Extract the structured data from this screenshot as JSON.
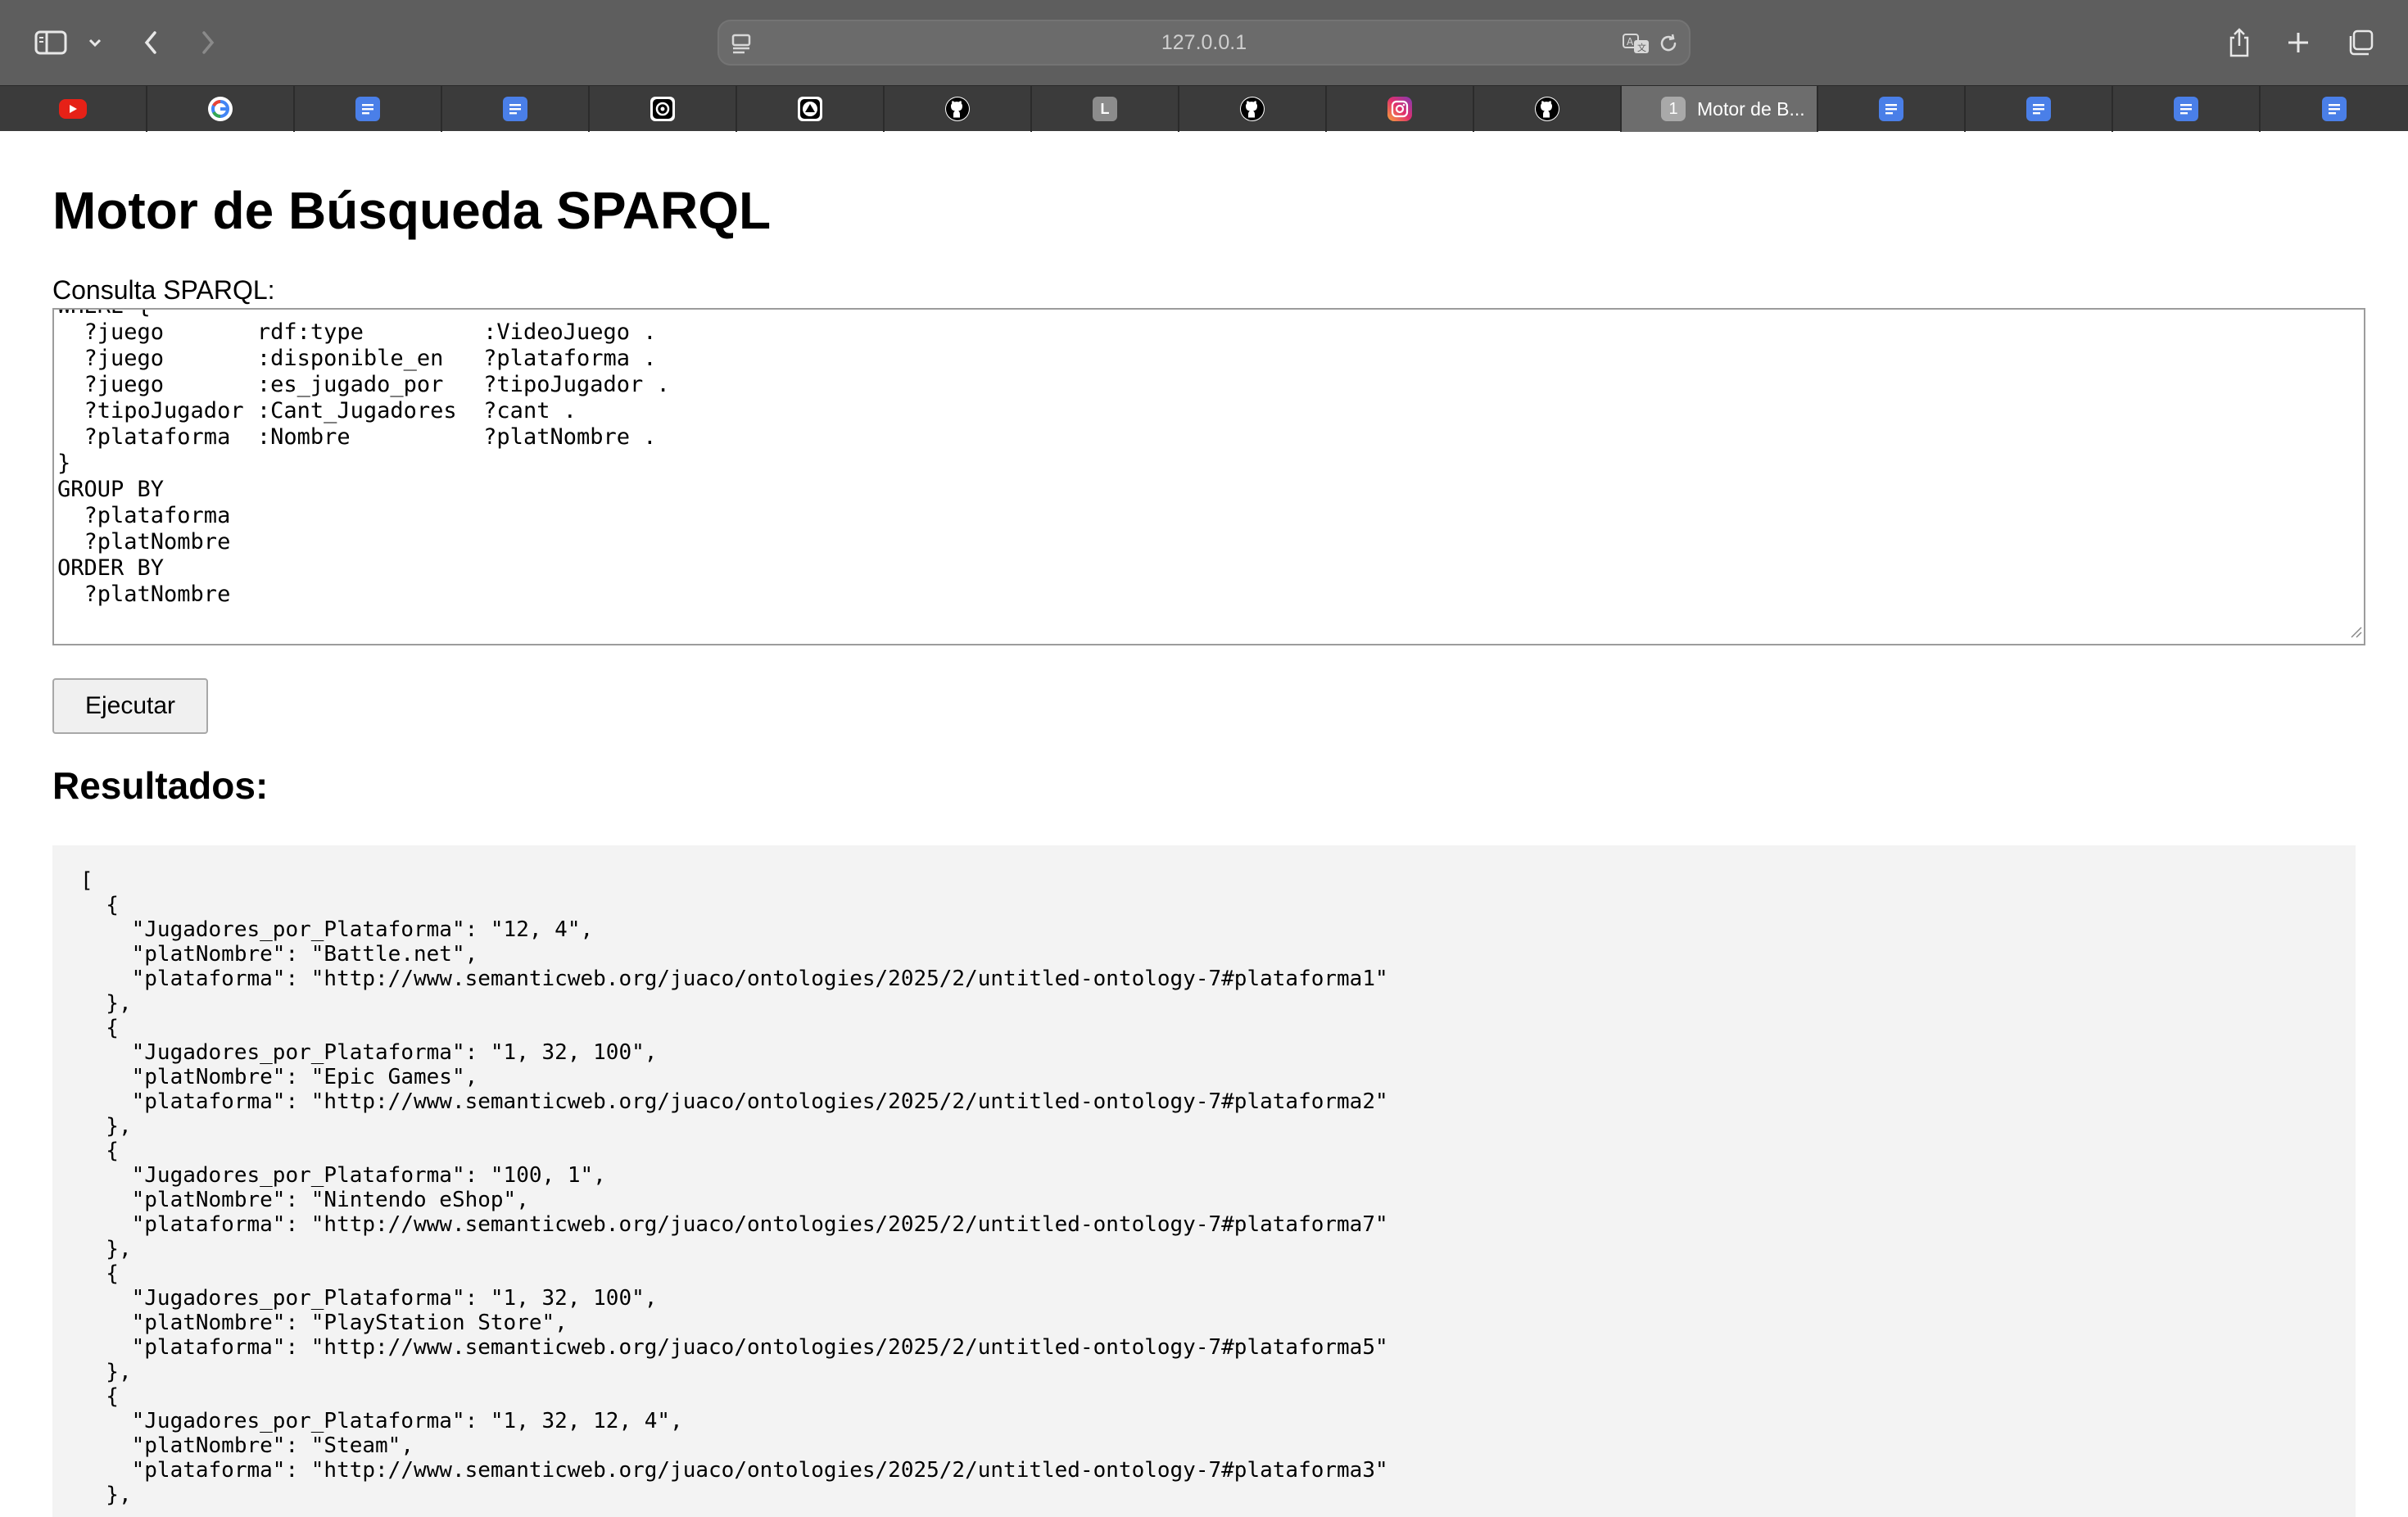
{
  "browser": {
    "url": "127.0.0.1",
    "tabs": [
      {
        "icon": "youtube-icon",
        "color": "#e62117"
      },
      {
        "icon": "google-icon",
        "color": "#ffffff"
      },
      {
        "icon": "google-docs-icon",
        "color": "#4a7fe8"
      },
      {
        "icon": "google-docs-icon",
        "color": "#4a7fe8"
      },
      {
        "icon": "openai-icon",
        "color": "#000000"
      },
      {
        "icon": "notion-like-icon",
        "color": "#000000"
      },
      {
        "icon": "github-icon",
        "color": "#000000"
      },
      {
        "icon": "letter-l-icon",
        "color": "#8c8c8c",
        "letter": "L"
      },
      {
        "icon": "github-icon",
        "color": "#000000"
      },
      {
        "icon": "instagram-icon",
        "color": "#d6249f"
      },
      {
        "icon": "github-icon",
        "color": "#000000"
      },
      {
        "active": true,
        "badge": "1",
        "title": "Motor de B..."
      },
      {
        "icon": "google-docs-icon",
        "color": "#4a7fe8"
      },
      {
        "icon": "google-docs-icon",
        "color": "#4a7fe8"
      },
      {
        "icon": "google-docs-icon",
        "color": "#4a7fe8"
      },
      {
        "icon": "google-docs-icon",
        "color": "#4a7fe8"
      }
    ]
  },
  "page": {
    "title": "Motor de Búsqueda SPARQL",
    "query_label": "Consulta SPARQL:",
    "query_text": "WHERE {\n  ?juego       rdf:type         :VideoJuego .\n  ?juego       :disponible_en   ?plataforma .\n  ?juego       :es_jugado_por   ?tipoJugador .\n  ?tipoJugador :Cant_Jugadores  ?cant .\n  ?plataforma  :Nombre          ?platNombre .\n}\nGROUP BY\n  ?plataforma\n  ?platNombre\nORDER BY\n  ?platNombre",
    "run_button": "Ejecutar",
    "results_heading": "Resultados:",
    "results_text": "[\n  {\n    \"Jugadores_por_Plataforma\": \"12, 4\",\n    \"platNombre\": \"Battle.net\",\n    \"plataforma\": \"http://www.semanticweb.org/juaco/ontologies/2025/2/untitled-ontology-7#plataforma1\"\n  },\n  {\n    \"Jugadores_por_Plataforma\": \"1, 32, 100\",\n    \"platNombre\": \"Epic Games\",\n    \"plataforma\": \"http://www.semanticweb.org/juaco/ontologies/2025/2/untitled-ontology-7#plataforma2\"\n  },\n  {\n    \"Jugadores_por_Plataforma\": \"100, 1\",\n    \"platNombre\": \"Nintendo eShop\",\n    \"plataforma\": \"http://www.semanticweb.org/juaco/ontologies/2025/2/untitled-ontology-7#plataforma7\"\n  },\n  {\n    \"Jugadores_por_Plataforma\": \"1, 32, 100\",\n    \"platNombre\": \"PlayStation Store\",\n    \"plataforma\": \"http://www.semanticweb.org/juaco/ontologies/2025/2/untitled-ontology-7#plataforma5\"\n  },\n  {\n    \"Jugadores_por_Plataforma\": \"1, 32, 12, 4\",\n    \"platNombre\": \"Steam\",\n    \"plataforma\": \"http://www.semanticweb.org/juaco/ontologies/2025/2/untitled-ontology-7#plataforma3\"\n  },"
  }
}
